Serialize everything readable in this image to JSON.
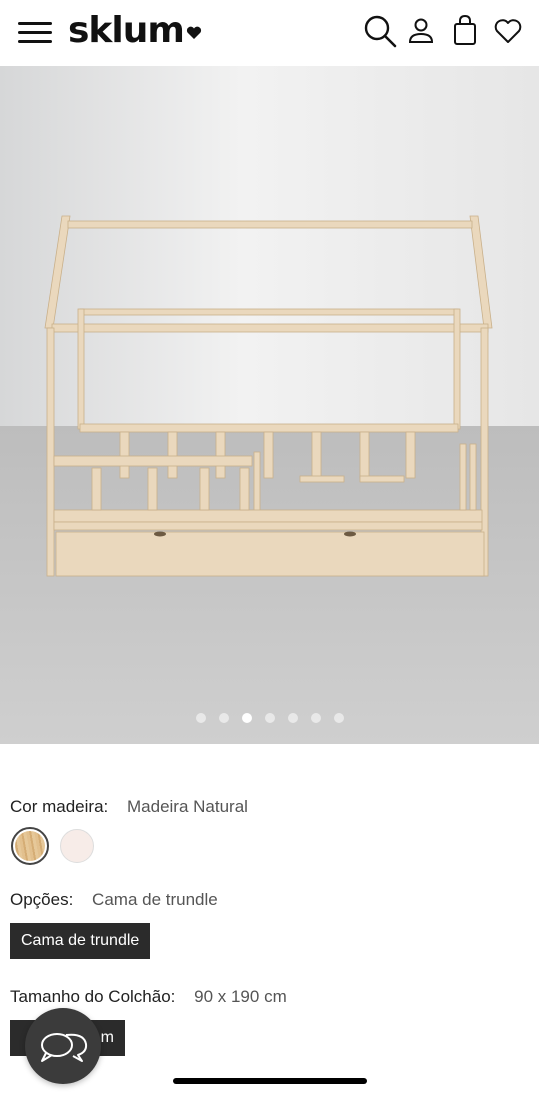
{
  "header": {
    "logo_text": "sklum",
    "icons": [
      "menu-icon",
      "search-icon",
      "account-icon",
      "cart-icon",
      "wishlist-icon"
    ]
  },
  "gallery": {
    "dot_count": 7,
    "active_index": 2
  },
  "options": {
    "wood_color": {
      "label": "Cor madeira:",
      "value": "Madeira Natural",
      "swatches": [
        {
          "name": "Madeira Natural",
          "color": "#d9b98a",
          "selected": true
        },
        {
          "name": "Branco",
          "color": "#f7ece8",
          "selected": false
        }
      ]
    },
    "options_group": {
      "label": "Opções:",
      "value": "Cama de trundle",
      "chip_label": "Cama de trundle"
    },
    "mattress_size": {
      "label": "Tamanho do Colchão:",
      "value": "90 x 190 cm",
      "chip_label_visible": "m"
    }
  },
  "colors": {
    "chip_bg": "#2b2b2b",
    "chat_bg": "#3b3b3b"
  }
}
